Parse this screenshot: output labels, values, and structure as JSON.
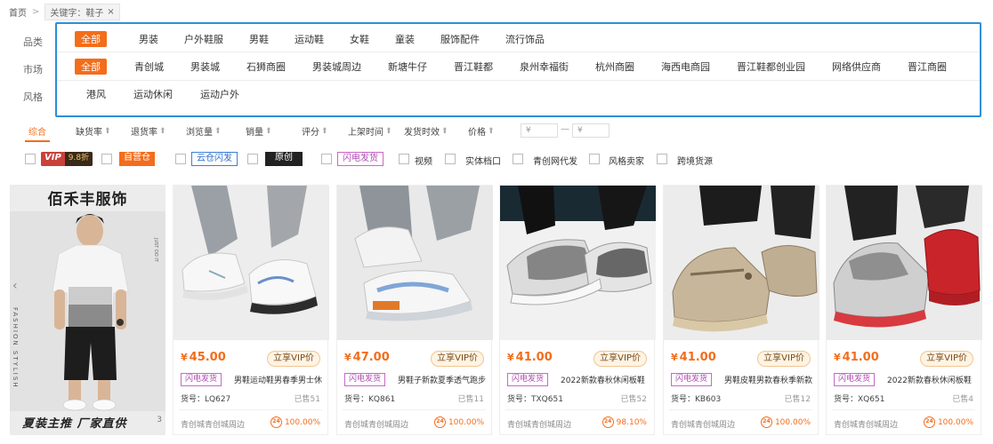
{
  "breadcrumb": {
    "home": "首页",
    "separator": ">",
    "keyword_tag": "关键字：鞋子",
    "close": "×"
  },
  "filters": {
    "category": {
      "label": "品类",
      "items": [
        "全部",
        "男装",
        "户外鞋服",
        "男鞋",
        "运动鞋",
        "女鞋",
        "童装",
        "服饰配件",
        "流行饰品"
      ]
    },
    "market": {
      "label": "市场",
      "items": [
        "全部",
        "青创城",
        "男装城",
        "石狮商圈",
        "男装城周边",
        "新塘牛仔",
        "晋江鞋都",
        "泉州幸福街",
        "杭州商圈",
        "海西电商园",
        "晋江鞋都创业园",
        "网络供应商",
        "晋江商圈"
      ]
    },
    "style": {
      "label": "风格",
      "items": [
        "港风",
        "运动休闲",
        "运动户外"
      ]
    }
  },
  "sort": {
    "items": [
      "综合",
      "缺货率",
      "退货率",
      "浏览量",
      "销量",
      "评分",
      "上架时间",
      "发货时效",
      "价格"
    ],
    "price_min_placeholder": "¥",
    "price_max_placeholder": "¥",
    "range_dash": "—"
  },
  "checks": {
    "vip_text": "VIP",
    "vip_discount": "9.8折",
    "self_operated": "自营仓",
    "cloud": "云仓闪发",
    "original": "原创",
    "flash": "闪电发货",
    "video": "视频",
    "store": "实体档口",
    "proxy": "青创网代发",
    "style_seller": "风格卖家",
    "cross_border": "跨境货源"
  },
  "ad": {
    "title": "佰禾丰服饰",
    "slogan": "夏装主推  厂家直供",
    "vertical": "FASHION STYLISH",
    "page": "3"
  },
  "products": [
    {
      "price": "45.00",
      "vip": "立享VIP价",
      "flash": "闪电发货",
      "title": "男鞋运动鞋男春季男士休",
      "code": "货号：LQ627",
      "sold": "已售51",
      "market": "青创城青创城周边",
      "rate": "100.00%"
    },
    {
      "price": "47.00",
      "vip": "立享VIP价",
      "flash": "闪电发货",
      "title": "男鞋子新款夏季透气跑步",
      "code": "货号：KQ861",
      "sold": "已售11",
      "market": "青创城青创城周边",
      "rate": "100.00%"
    },
    {
      "price": "41.00",
      "vip": "立享VIP价",
      "flash": "闪电发货",
      "title": "2022新款春秋休闲板鞋",
      "code": "货号：TXQ651",
      "sold": "已售52",
      "market": "青创城青创城周边",
      "rate": "98.10%"
    },
    {
      "price": "41.00",
      "vip": "立享VIP价",
      "flash": "闪电发货",
      "title": "男鞋皮鞋男款春秋季新款",
      "code": "货号：KB603",
      "sold": "已售12",
      "market": "青创城青创城周边",
      "rate": "100.00%"
    },
    {
      "price": "41.00",
      "vip": "立享VIP价",
      "flash": "闪电发货",
      "title": "2022新款春秋休闲板鞋",
      "code": "货号：XQ651",
      "sold": "已售4",
      "market": "青创城青创城周边",
      "rate": "100.00%"
    }
  ],
  "currency": "¥",
  "rate_icon": "24",
  "colors": {
    "accent": "#f36d1b",
    "highlight_border": "#2d8fd8",
    "flash_badge": "#b04ab2"
  }
}
